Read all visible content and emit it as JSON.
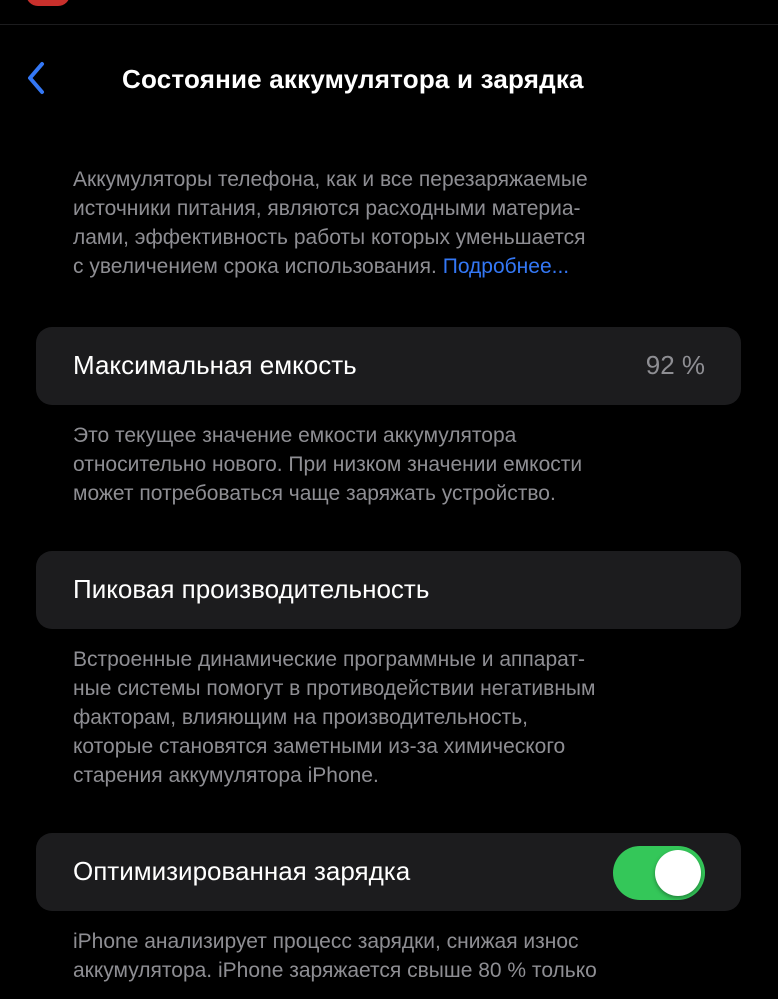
{
  "nav": {
    "title": "Состояние аккумулятора и зарядка",
    "back_icon": "chevron-left-icon"
  },
  "intro": {
    "lines": [
      "Аккумуляторы телефона, как и все перезаряжаемые",
      "источники питания, являются расходными материа-",
      "лами, эффективность работы которых уменьшается",
      "с увеличением срока использования."
    ],
    "link": "Подробнее..."
  },
  "max_capacity": {
    "label": "Максимальная емкость",
    "value": "92 %",
    "footer": [
      "Это текущее значение емкости аккумулятора",
      "относительно нового. При низком значении емкости",
      "может потребоваться чаще заряжать устройство."
    ]
  },
  "peak_performance": {
    "label": "Пиковая производительность",
    "footer": [
      "Встроенные динамические программные и аппарат-",
      "ные системы помогут в противодействии негативным",
      "факторам, влияющим на производительность,",
      "которые становятся заметными из-за химического",
      "старения аккумулятора iPhone."
    ]
  },
  "optimized_charging": {
    "label": "Оптимизированная зарядка",
    "enabled": true,
    "footer": [
      "iPhone анализирует процесс зарядки, снижая износ",
      "аккумулятора. iPhone заряжается свыше 80 % только"
    ]
  },
  "colors": {
    "accent": "#3478f6",
    "toggle_on": "#34c759",
    "cell_bg": "#1c1c1e",
    "secondary_text": "#8e8e93"
  }
}
